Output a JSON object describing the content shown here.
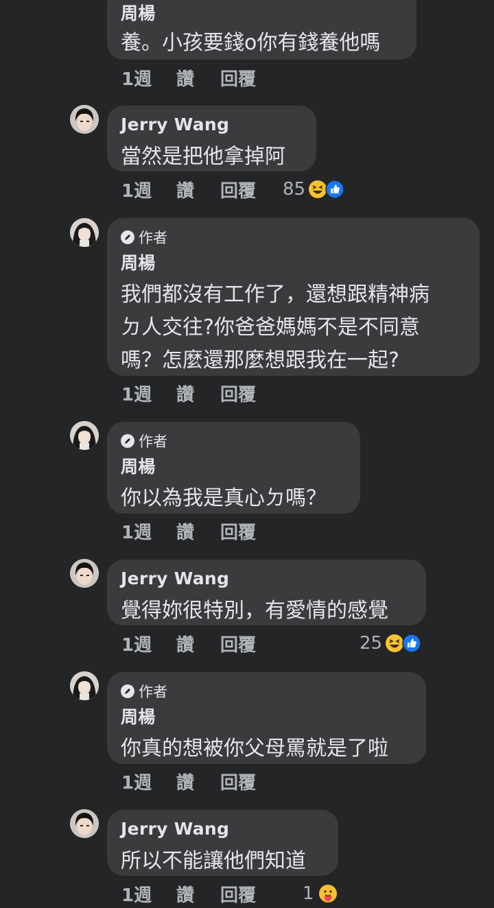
{
  "labels": {
    "author": "作者",
    "like": "讚",
    "reply": "回覆"
  },
  "icons": {
    "author_badge": "pen-icon",
    "haha": "haha-emoji-icon",
    "like": "like-thumb-icon",
    "care": "care-emoji-icon"
  },
  "colors": {
    "background": "#242526",
    "bubble": "#3a3b3c",
    "text": "#e4e6eb",
    "muted": "#b0b3b8",
    "like_blue": "#1877f2",
    "emoji_yellow": "#f7c132"
  },
  "comments": [
    {
      "name": "周楊",
      "lines": [
        "養。小孩要錢o你有錢養他嗎"
      ],
      "time": "1週"
    },
    {
      "name": "Jerry Wang",
      "lines": [
        "當然是把他拿掉阿"
      ],
      "time": "1週",
      "reaction_count": "85"
    },
    {
      "name": "周楊",
      "author_badge": "作者",
      "lines": [
        "我們都沒有工作了，還想跟精神病",
        "ㄉ人交往?你爸爸媽媽不是不同意",
        "嗎？怎麼還那麼想跟我在一起?"
      ],
      "time": "1週"
    },
    {
      "name": "周楊",
      "author_badge": "作者",
      "lines": [
        "你以為我是真心ㄉ嗎？"
      ],
      "time": "1週"
    },
    {
      "name": "Jerry Wang",
      "lines": [
        "覺得妳很特別，有愛情的感覺"
      ],
      "time": "1週",
      "reaction_count": "25"
    },
    {
      "name": "周楊",
      "author_badge": "作者",
      "lines": [
        "你真的想被你父母罵就是了啦"
      ],
      "time": "1週"
    },
    {
      "name": "Jerry Wang",
      "lines": [
        "所以不能讓他們知道"
      ],
      "time": "1週",
      "reaction_count": "1"
    }
  ]
}
